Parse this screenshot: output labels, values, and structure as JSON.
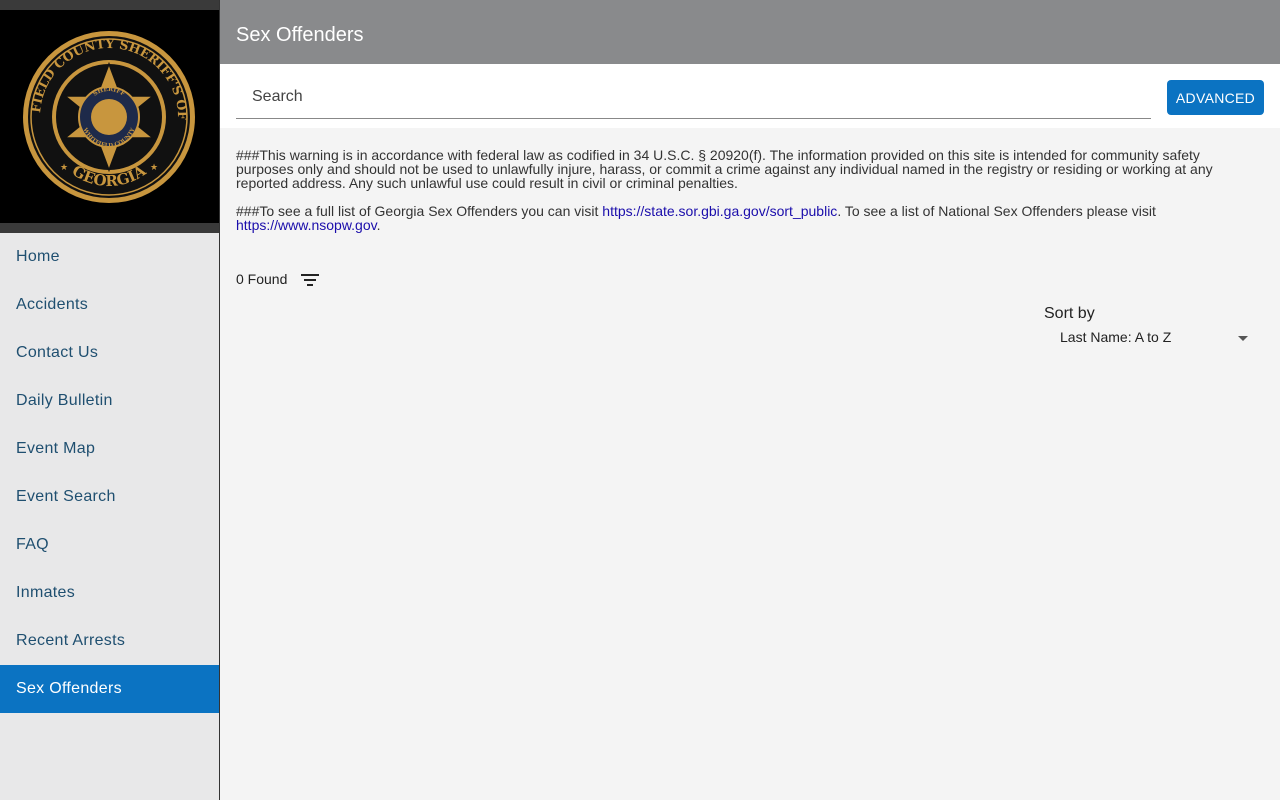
{
  "sidebar": {
    "logo": {
      "ring_text_top": "WHITFIELD COUNTY SHERIFF'S OFFICE",
      "ring_text_bottom": "GEORGIA",
      "star_text_top": "SHERIFF",
      "star_text_bottom": "WHITFIELD COUNTY",
      "colors": {
        "gold": "#c8963e",
        "dark": "#111111",
        "inner": "#1e2a4a"
      }
    },
    "items": [
      {
        "label": "Home"
      },
      {
        "label": "Accidents"
      },
      {
        "label": "Contact Us"
      },
      {
        "label": "Daily Bulletin"
      },
      {
        "label": "Event Map"
      },
      {
        "label": "Event Search"
      },
      {
        "label": "FAQ"
      },
      {
        "label": "Inmates"
      },
      {
        "label": "Recent Arrests"
      },
      {
        "label": "Sex Offenders",
        "active": true
      }
    ]
  },
  "header": {
    "title": "Sex Offenders"
  },
  "search": {
    "placeholder": "Search",
    "value": "",
    "advanced_label": "ADVANCED"
  },
  "notice": {
    "warning": "###This warning is in accordance with federal law as codified in 34 U.S.C. § 20920(f). The information provided on this site is intended for community safety purposes only and should not be used to unlawfully injure, harass, or commit a crime against any individual named in the registry or residing or working at any reported address. Any such unlawful use could result in civil or criminal penalties.",
    "list_prefix": "###To see a full list of Georgia Sex Offenders you can visit ",
    "georgia_link": "https://state.sor.gbi.ga.gov/sort_public",
    "list_middle": ". To see a list of National Sex Offenders please visit ",
    "national_link": "https://www.nsopw.gov",
    "list_suffix": "."
  },
  "results": {
    "found_label": "0 Found",
    "filter_icon": "filter-list-icon"
  },
  "sort": {
    "label": "Sort by",
    "selected": "Last Name: A to Z"
  },
  "colors": {
    "accent": "#0b73c2",
    "header_bg": "#898a8c",
    "nav_text": "#1f4f70",
    "sidebar_bg": "#e8e8e9"
  }
}
